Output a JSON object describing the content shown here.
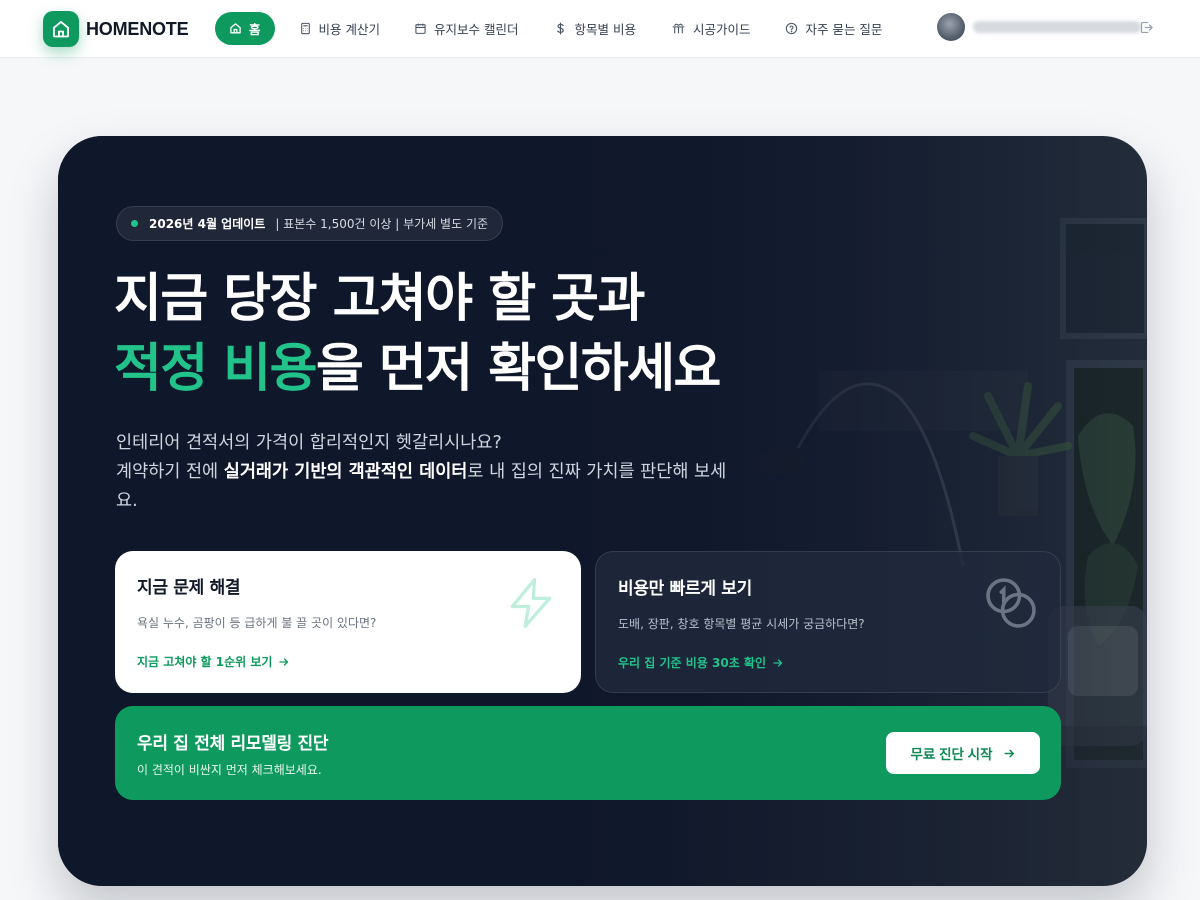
{
  "brand": {
    "name": "HOMENOTE"
  },
  "nav": {
    "items": [
      {
        "label": "홈",
        "icon": "home-icon",
        "active": true
      },
      {
        "label": "비용 계산기",
        "icon": "calculator-icon"
      },
      {
        "label": "유지보수 캘린더",
        "icon": "calendar-icon"
      },
      {
        "label": "항목별 비용",
        "icon": "dollar-icon"
      },
      {
        "label": "시공가이드",
        "icon": "tools-icon"
      },
      {
        "label": "자주 묻는 질문",
        "icon": "help-circle-icon"
      }
    ]
  },
  "user": {
    "name": "••••••••••"
  },
  "hero": {
    "badge": {
      "strong": "2026년 4월 업데이트",
      "meta": "| 표본수 1,500건 이상 | 부가세 별도 기준"
    },
    "headline": {
      "line1": "지금 당장 고쳐야 할 곳과",
      "accent": "적정 비용",
      "line2_rest": "을 먼저 확인하세요"
    },
    "sub": {
      "line1": "인테리어 견적서의 가격이 합리적인지 헷갈리시나요?",
      "line2_pre": "계약하기 전에 ",
      "line2_bold": "실거래가 기반의 객관적인 데이터",
      "line2_post": "로 내 집의 진짜 가치를 판단해 보세요."
    },
    "cards": [
      {
        "title": "지금 문제 해결",
        "desc": "욕실 누수, 곰팡이 등 급하게 불 끌 곳이 있다면?",
        "link": "지금 고쳐야 할 1순위 보기",
        "icon": "lightning-icon"
      },
      {
        "title": "비용만 빠르게 보기",
        "desc": "도배, 장판, 창호 항목별 평균 시세가 궁금하다면?",
        "link": "우리 집 기준 비용 30초 확인",
        "icon": "coins-icon"
      }
    ],
    "cta": {
      "title": "우리 집 전체 리모델링 진단",
      "desc": "이 견적이 비싼지 먼저 체크해보세요.",
      "button": "무료 진단 시작"
    }
  },
  "colors": {
    "brand_green": "#0e9a5e",
    "accent_green": "#22c38a",
    "hero_dark": "#0f172a",
    "page_bg": "#f6f7f9"
  }
}
